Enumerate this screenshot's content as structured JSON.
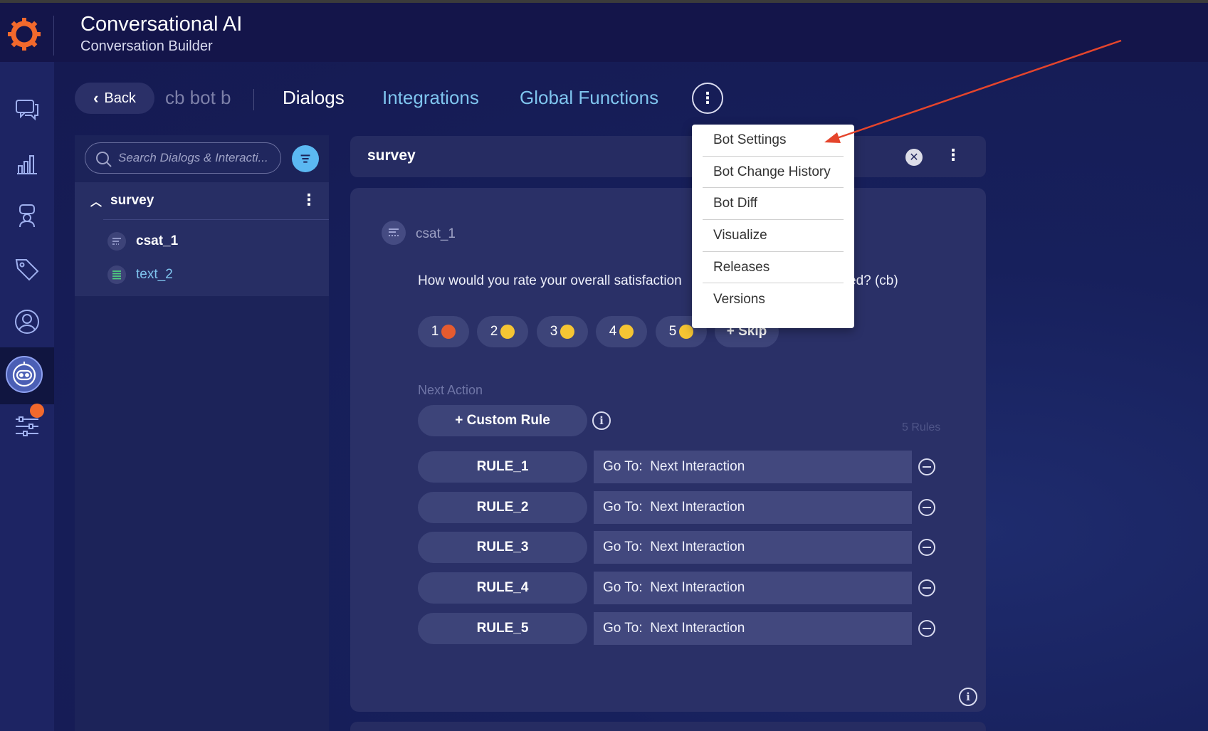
{
  "header": {
    "title": "Conversational AI",
    "subtitle": "Conversation Builder"
  },
  "rail": {
    "items": [
      "chat-icon",
      "analytics-icon",
      "agent-icon",
      "tag-icon",
      "user-icon",
      "bot-icon",
      "settings-sliders-icon"
    ],
    "active": "bot-icon",
    "badge_color": "#f2692c"
  },
  "nav": {
    "back_label": "Back",
    "bot_name": "cb bot b",
    "tabs": [
      {
        "label": "Dialogs"
      },
      {
        "label": "Integrations"
      },
      {
        "label": "Global Functions"
      }
    ],
    "more_label": "⋮"
  },
  "sidebar": {
    "search_placeholder": "Search Dialogs & Interacti...",
    "dialog": {
      "label": "survey"
    },
    "interactions": [
      {
        "label": "csat_1"
      },
      {
        "label": "text_2"
      }
    ]
  },
  "dialog": {
    "title": "survey",
    "interaction_name": "csat_1",
    "question_start": "How would you rate your overall satisfaction",
    "question_end": "ed? (cb)",
    "quick_replies": [
      {
        "label": "1"
      },
      {
        "label": "2"
      },
      {
        "label": "3"
      },
      {
        "label": "4"
      },
      {
        "label": "5"
      }
    ],
    "skip_label": "+ Skip",
    "next_action_label": "Next Action",
    "custom_rule_label": "+ Custom Rule",
    "rules_count": "5 Rules",
    "rules": [
      {
        "name": "RULE_1",
        "goto_label": "Go To:",
        "target": "Next Interaction"
      },
      {
        "name": "RULE_2",
        "goto_label": "Go To:",
        "target": "Next Interaction"
      },
      {
        "name": "RULE_3",
        "goto_label": "Go To:",
        "target": "Next Interaction"
      },
      {
        "name": "RULE_4",
        "goto_label": "Go To:",
        "target": "Next Interaction"
      },
      {
        "name": "RULE_5",
        "goto_label": "Go To:",
        "target": "Next Interaction"
      }
    ]
  },
  "menu": {
    "items": [
      {
        "label": "Bot Settings"
      },
      {
        "label": "Bot Change History"
      },
      {
        "label": "Bot Diff"
      },
      {
        "label": "Visualize"
      },
      {
        "label": "Releases"
      },
      {
        "label": "Versions"
      }
    ]
  },
  "colors": {
    "accent_link": "#7fc4ee",
    "annotation_arrow": "#e5452c",
    "brand_orange": "#f2692c"
  }
}
